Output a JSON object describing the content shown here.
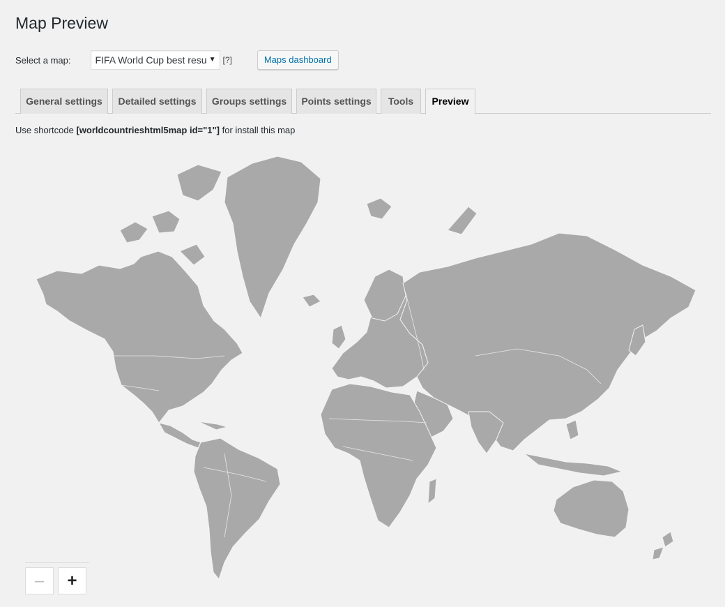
{
  "page": {
    "title": "Map Preview"
  },
  "map_select": {
    "label": "Select a map:",
    "selected": "FIFA World Cup best resu",
    "arrow": "▼",
    "help": "[?]",
    "dashboard_button": "Maps dashboard"
  },
  "tabs": [
    {
      "label": "General settings",
      "active": false
    },
    {
      "label": "Detailed settings",
      "active": false
    },
    {
      "label": "Groups settings",
      "active": false
    },
    {
      "label": "Points settings",
      "active": false
    },
    {
      "label": "Tools",
      "active": false
    },
    {
      "label": "Preview",
      "active": true
    }
  ],
  "shortcode": {
    "prefix": "Use shortcode ",
    "code": "[worldcountrieshtml5map id=\"1\"]",
    "suffix": " for install this map"
  },
  "map": {
    "land_color": "#a9a9a9",
    "border_color": "#f2f2f2"
  },
  "zoom": {
    "out_label": "–",
    "in_label": "+"
  }
}
